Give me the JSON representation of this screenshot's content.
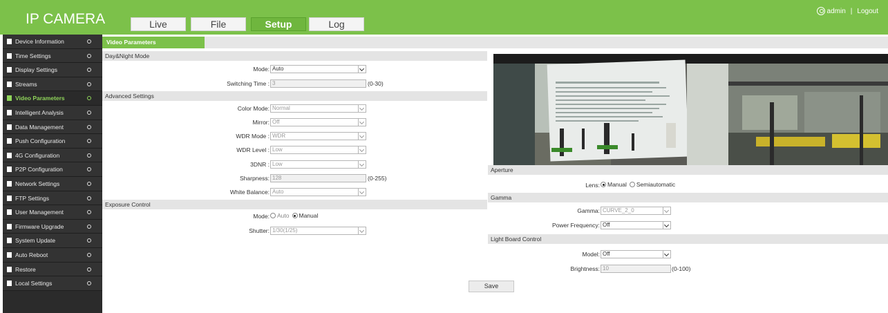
{
  "header": {
    "brand": "IP CAMERA",
    "tabs": [
      {
        "label": "Live"
      },
      {
        "label": "File"
      },
      {
        "label": "Setup"
      },
      {
        "label": "Log"
      }
    ],
    "user": "admin",
    "logout": "Logout",
    "separator": "|",
    "colors": {
      "bar": "#7cc14a",
      "active_tab": "#6fb63e"
    }
  },
  "sidebar": {
    "items": [
      {
        "label": "Device Information"
      },
      {
        "label": "Time Settings"
      },
      {
        "label": "Display Settings"
      },
      {
        "label": "Streams"
      },
      {
        "label": "Video Parameters"
      },
      {
        "label": "Intelligent Analysis"
      },
      {
        "label": "Data Management"
      },
      {
        "label": "Push Configuration"
      },
      {
        "label": "4G Configuration"
      },
      {
        "label": "P2P Configuration"
      },
      {
        "label": "Network Settings"
      },
      {
        "label": "FTP Settings"
      },
      {
        "label": "User Management"
      },
      {
        "label": "Firmware Upgrade"
      },
      {
        "label": "System Update"
      },
      {
        "label": "Auto Reboot"
      },
      {
        "label": "Restore"
      },
      {
        "label": "Local Settings"
      }
    ],
    "active_index": 4,
    "active_color": "#8fd45a"
  },
  "main": {
    "tab_title": "Video Parameters",
    "day_night": {
      "title": "Day&Night Mode",
      "mode_label": "Mode:",
      "mode_value": "Auto",
      "switch_label": "Switching Time :",
      "switch_value": "3",
      "switch_hint": "(0-30)"
    },
    "advanced": {
      "title": "Advanced Settings",
      "color_mode_label": "Color Mode:",
      "color_mode_value": "Normal",
      "mirror_label": "Mirror:",
      "mirror_value": "Off",
      "wdr_mode_label": "WDR Mode :",
      "wdr_mode_value": "WDR",
      "wdr_level_label": "WDR Level :",
      "wdr_level_value": "Low",
      "dnr_label": "3DNR :",
      "dnr_value": "Low",
      "sharpness_label": "Sharpness:",
      "sharpness_value": "128",
      "sharpness_hint": "(0-255)",
      "wb_label": "White Balance:",
      "wb_value": "Auto"
    },
    "exposure": {
      "title": "Exposure Control",
      "mode_label": "Mode:",
      "mode_auto": "Auto",
      "mode_manual": "Manual",
      "shutter_label": "Shutter:",
      "shutter_value": "1/30(1/25)"
    },
    "aperture": {
      "title": "Aperture",
      "lens_label": "Lens:",
      "lens_manual": "Manual",
      "lens_semi": "Semiautomatic"
    },
    "gamma": {
      "title": "Gamma",
      "gamma_label": "Gamma:",
      "gamma_value": "CURVE_2_0",
      "power_label": "Power Frequency:",
      "power_value": "Off"
    },
    "light_board": {
      "title": "Light Board Control",
      "model_label": "Model:",
      "model_value": "Off",
      "brightness_label": "Brightness:",
      "brightness_value": "10",
      "brightness_hint": "(0-100)"
    },
    "save_label": "Save"
  }
}
